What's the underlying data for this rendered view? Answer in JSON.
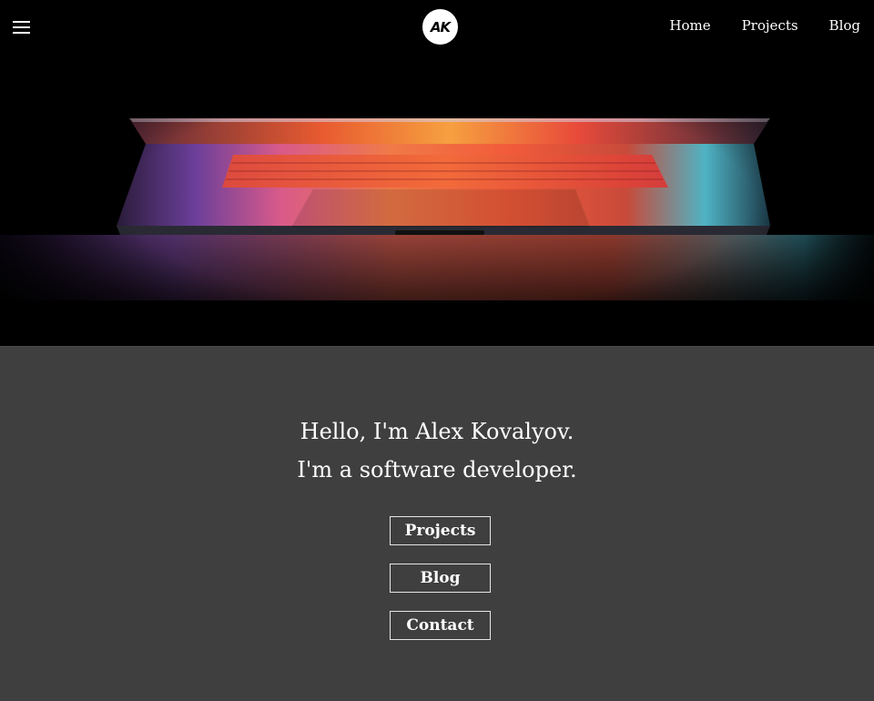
{
  "header": {
    "menu_icon": "hamburger-menu-icon",
    "logo_text": "AK",
    "nav": [
      {
        "label": "Home"
      },
      {
        "label": "Projects"
      },
      {
        "label": "Blog"
      }
    ]
  },
  "hero": {
    "image": "laptop-glowing-keyboard-photo"
  },
  "intro": {
    "line1": "Hello, I'm  Alex Kovalyov.",
    "line2": "I'm a software developer.",
    "buttons": [
      {
        "label": "Projects"
      },
      {
        "label": "Blog"
      },
      {
        "label": "Contact"
      }
    ]
  },
  "colors": {
    "header_bg": "#000000",
    "section_bg": "#3f3f3f",
    "text": "#ffffff",
    "button_border": "#e6e6e6"
  }
}
